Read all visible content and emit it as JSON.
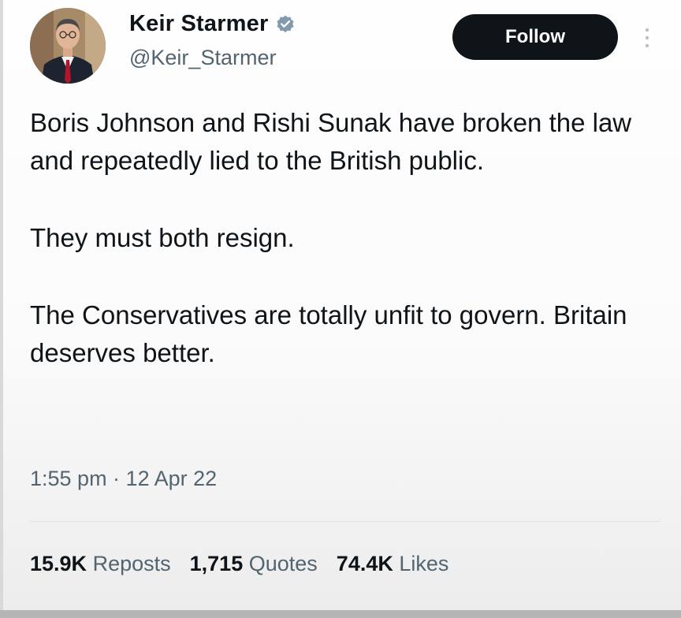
{
  "author": {
    "display_name": "Keir Starmer",
    "handle": "@Keir_Starmer",
    "verified": true,
    "avatar_icon": "profile-photo"
  },
  "follow_button": {
    "label": "Follow"
  },
  "more_menu": {
    "icon": "more-vertical-icon"
  },
  "tweet": {
    "paragraphs": [
      "Boris Johnson and Rishi Sunak have broken the law and repeatedly lied to the British public.",
      "They must both resign.",
      "The Conservatives are totally unfit to govern. Britain deserves better."
    ],
    "timestamp": "1:55 pm · 12 Apr 22"
  },
  "stats": [
    {
      "value": "15.9K",
      "label": "Reposts"
    },
    {
      "value": "1,715",
      "label": "Quotes"
    },
    {
      "value": "74.4K",
      "label": "Likes"
    }
  ],
  "colors": {
    "text_primary": "#0f1419",
    "text_secondary": "#536471",
    "follow_bg": "#0f1419",
    "verified_badge": "#829aab"
  }
}
